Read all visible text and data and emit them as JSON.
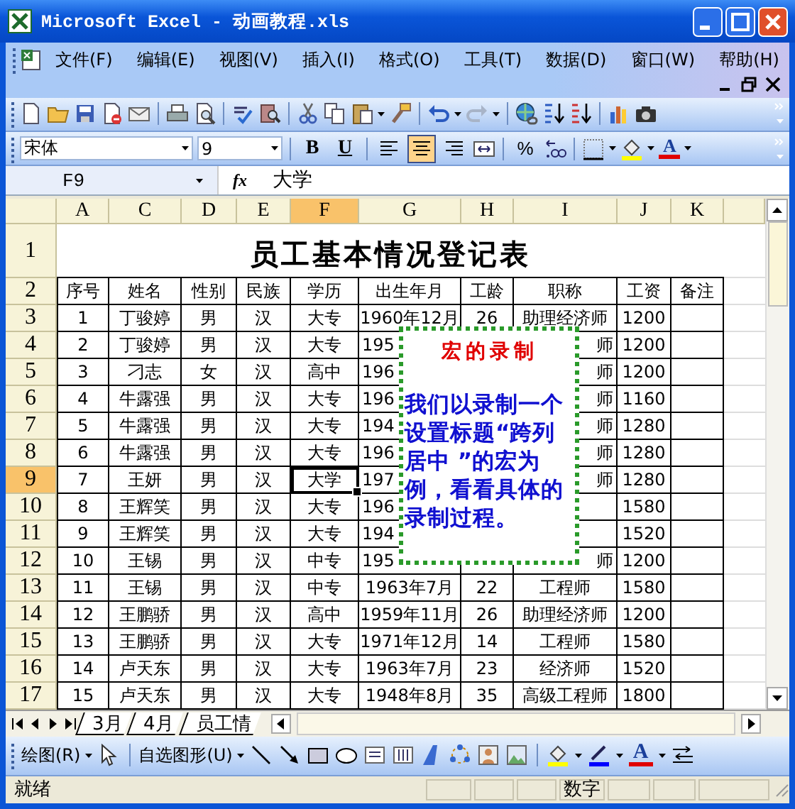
{
  "window": {
    "title": "Microsoft Excel - 动画教程.xls"
  },
  "menu": [
    "文件(F)",
    "编辑(E)",
    "视图(V)",
    "插入(I)",
    "格式(O)",
    "工具(T)",
    "数据(D)",
    "窗口(W)",
    "帮助(H)"
  ],
  "formatting_toolbar": {
    "font": "宋体",
    "size": "9",
    "bold": {
      "label": "B",
      "selected": false
    },
    "underline": {
      "label": "U",
      "selected": false
    },
    "alignment": [
      {
        "kind": "left",
        "selected": false
      },
      {
        "kind": "center",
        "selected": true
      },
      {
        "kind": "right",
        "selected": false
      }
    ],
    "percent": "%",
    "font_color": "A"
  },
  "formula_bar": {
    "name_box": "F9",
    "function_label": "fx",
    "value": "大学"
  },
  "sheet": {
    "columns": [
      {
        "label": "A",
        "selected": false
      },
      {
        "label": "C",
        "selected": false
      },
      {
        "label": "D",
        "selected": false
      },
      {
        "label": "E",
        "selected": false
      },
      {
        "label": "F",
        "selected": true
      },
      {
        "label": "G",
        "selected": false
      },
      {
        "label": "H",
        "selected": false
      },
      {
        "label": "I",
        "selected": false
      },
      {
        "label": "J",
        "selected": false
      },
      {
        "label": "K",
        "selected": false
      }
    ],
    "rows": [
      {
        "number": "1",
        "kind": "title",
        "selected": false,
        "title": "员工基本情况登记表"
      },
      {
        "number": "2",
        "kind": "header",
        "selected": false,
        "cells": {
          "a": "序号",
          "c": "姓名",
          "d": "性别",
          "e": "民族",
          "f": "学历",
          "g": "出生年月",
          "h": "工龄",
          "i": "职称",
          "j": "工资",
          "k": "备注"
        }
      },
      {
        "number": "3",
        "kind": "data",
        "selected": false,
        "cells": {
          "a": "1",
          "c": "丁骏婷",
          "d": "男",
          "e": "汉",
          "f": "大专",
          "g": "1960年12月",
          "h": "26",
          "i": "助理经济师",
          "j": "1200"
        }
      },
      {
        "number": "4",
        "kind": "data",
        "selected": false,
        "cells": {
          "a": "2",
          "c": "丁骏婷",
          "d": "男",
          "e": "汉",
          "f": "大专",
          "g": "195",
          "i": "师",
          "j": "1200"
        }
      },
      {
        "number": "5",
        "kind": "data",
        "selected": false,
        "cells": {
          "a": "3",
          "c": "刁志",
          "d": "女",
          "e": "汉",
          "f": "高中",
          "g": "196",
          "i": "师",
          "j": "1200"
        }
      },
      {
        "number": "6",
        "kind": "data",
        "selected": false,
        "cells": {
          "a": "4",
          "c": "牛露强",
          "d": "男",
          "e": "汉",
          "f": "大专",
          "g": "196",
          "i": "师",
          "j": "1160"
        }
      },
      {
        "number": "7",
        "kind": "data",
        "selected": false,
        "cells": {
          "a": "5",
          "c": "牛露强",
          "d": "男",
          "e": "汉",
          "f": "大专",
          "g": "194",
          "i": "师",
          "j": "1280"
        }
      },
      {
        "number": "8",
        "kind": "data",
        "selected": false,
        "cells": {
          "a": "6",
          "c": "牛露强",
          "d": "男",
          "e": "汉",
          "f": "大专",
          "g": "196",
          "i": "师",
          "j": "1280"
        }
      },
      {
        "number": "9",
        "kind": "data",
        "selected": true,
        "cells": {
          "a": "7",
          "c": "王妍",
          "d": "男",
          "e": "汉",
          "f": "大学",
          "g": "197",
          "i": "师",
          "j": "1280"
        }
      },
      {
        "number": "10",
        "kind": "data",
        "selected": false,
        "cells": {
          "a": "8",
          "c": "王辉笑",
          "d": "男",
          "e": "汉",
          "f": "大专",
          "g": "196",
          "j": "1580"
        }
      },
      {
        "number": "11",
        "kind": "data",
        "selected": false,
        "cells": {
          "a": "9",
          "c": "王辉笑",
          "d": "男",
          "e": "汉",
          "f": "大专",
          "g": "194",
          "j": "1520"
        }
      },
      {
        "number": "12",
        "kind": "data",
        "selected": false,
        "cells": {
          "a": "10",
          "c": "王锡",
          "d": "男",
          "e": "汉",
          "f": "中专",
          "g": "195",
          "i": "师",
          "j": "1200"
        }
      },
      {
        "number": "13",
        "kind": "data",
        "selected": false,
        "cells": {
          "a": "11",
          "c": "王锡",
          "d": "男",
          "e": "汉",
          "f": "中专",
          "g": "1963年7月",
          "h": "22",
          "i": "工程师",
          "j": "1580"
        }
      },
      {
        "number": "14",
        "kind": "data",
        "selected": false,
        "cells": {
          "a": "12",
          "c": "王鹏骄",
          "d": "男",
          "e": "汉",
          "f": "高中",
          "g": "1959年11月",
          "h": "26",
          "i": "助理经济师",
          "j": "1200"
        }
      },
      {
        "number": "15",
        "kind": "data",
        "selected": false,
        "cells": {
          "a": "13",
          "c": "王鹏骄",
          "d": "男",
          "e": "汉",
          "f": "大专",
          "g": "1971年12月",
          "h": "14",
          "i": "工程师",
          "j": "1580"
        }
      },
      {
        "number": "16",
        "kind": "data",
        "selected": false,
        "cells": {
          "a": "14",
          "c": "卢天东",
          "d": "男",
          "e": "汉",
          "f": "大专",
          "g": "1963年7月",
          "h": "23",
          "i": "经济师",
          "j": "1520"
        }
      },
      {
        "number": "17",
        "kind": "data",
        "selected": false,
        "cells": {
          "a": "15",
          "c": "卢天东",
          "d": "男",
          "e": "汉",
          "f": "大专",
          "g": "1948年8月",
          "h": "35",
          "i": "高级工程师",
          "j": "1800"
        }
      }
    ]
  },
  "callout": {
    "title": "宏的录制",
    "text": "我们以录制一个设置标题“跨列居中 ”的宏为例，看看具体的录制过程。"
  },
  "sheet_tabs": [
    "3月",
    "4月",
    "员工情"
  ],
  "drawing_toolbar": {
    "draw_menu": "绘图(R)",
    "autoshapes": "自选图形(U)",
    "font_color": "A"
  },
  "status_bar": {
    "text": "就绪",
    "indicator": "数字"
  }
}
